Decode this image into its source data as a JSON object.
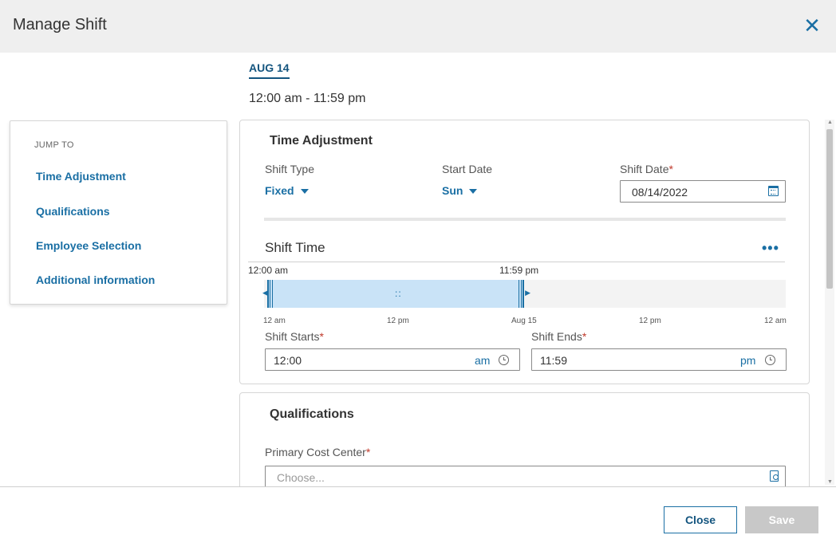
{
  "header": {
    "title": "Manage Shift"
  },
  "date_tab": "AUG 14",
  "date_range": "12:00 am - 11:59 pm",
  "jump_to": {
    "title": "JUMP TO",
    "links": [
      "Time Adjustment",
      "Qualifications",
      "Employee Selection",
      "Additional information"
    ]
  },
  "time_adjustment": {
    "title": "Time Adjustment",
    "shift_type": {
      "label": "Shift Type",
      "value": "Fixed"
    },
    "start_date": {
      "label": "Start Date",
      "value": "Sun"
    },
    "shift_date": {
      "label": "Shift Date",
      "required_mark": "*",
      "value": "08/14/2022"
    }
  },
  "shift_time": {
    "title": "Shift Time",
    "more": "•••",
    "range_start_label": "12:00 am",
    "range_end_label": "11:59 pm",
    "grip": "::",
    "ticks": [
      "12 am",
      "12 pm",
      "Aug 15",
      "12 pm",
      "12 am"
    ],
    "shift_starts": {
      "label": "Shift Starts",
      "required_mark": "*",
      "value": "12:00",
      "ampm": "am"
    },
    "shift_ends": {
      "label": "Shift Ends",
      "required_mark": "*",
      "value": "11:59",
      "ampm": "pm"
    }
  },
  "qualifications": {
    "title": "Qualifications",
    "primary_cost_center": {
      "label": "Primary Cost Center",
      "required_mark": "*",
      "placeholder": "Choose..."
    }
  },
  "footer": {
    "close_label": "Close",
    "save_label": "Save"
  },
  "colors": {
    "accent": "#1a6fa4",
    "range_fill": "#c9e3f7",
    "required": "#c0392b",
    "disabled_button": "#c8c8c8"
  },
  "icons": [
    "close-icon",
    "calendar-icon",
    "clock-icon",
    "search-document-icon",
    "more-options-icon"
  ]
}
